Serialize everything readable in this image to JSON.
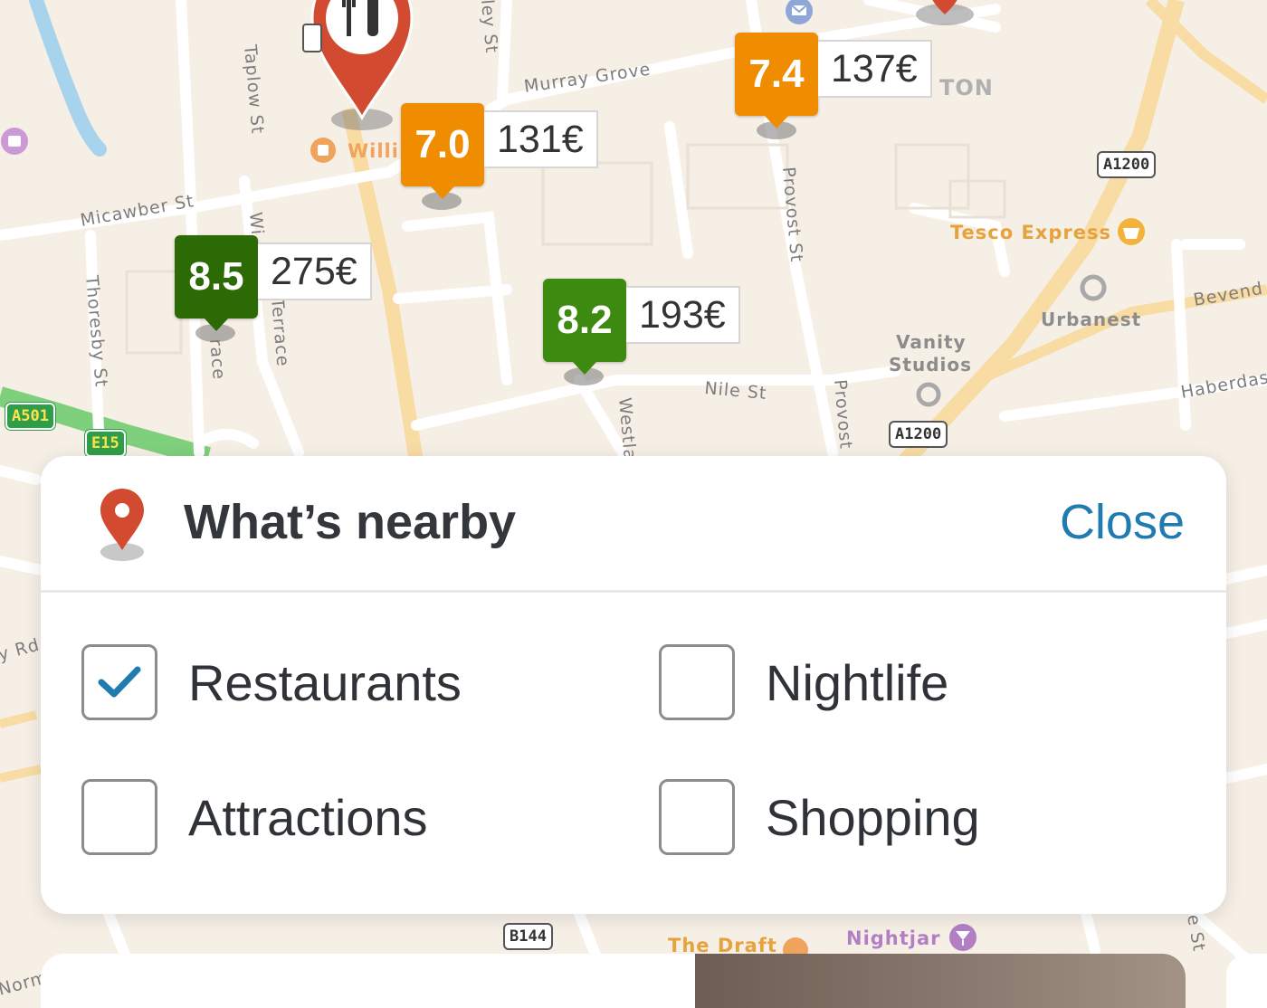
{
  "map": {
    "streets": [
      "Murray Grove",
      "Micawber St",
      "Taplow St",
      "Thoresby St",
      "Provost St",
      "Nile St",
      "Westla",
      "Provost",
      "Haberdas",
      "Bevend",
      "Wi",
      "Terrace",
      "race",
      "ley St",
      "y Rd",
      "Norm",
      "e St"
    ],
    "pois": {
      "tesco": "Tesco Express",
      "urbanest": "Urbanest",
      "vanity": "Vanity",
      "studios": "Studios",
      "ton": "TON",
      "willi": "Willi",
      "draft": "The Draft",
      "nightjar": "Nightjar"
    },
    "shields": {
      "a1200_top": "A1200",
      "a1200_mid": "A1200",
      "a501": "A501",
      "e15": "E15",
      "b144": "B144"
    }
  },
  "hotels": [
    {
      "score": "7.0",
      "price": "131€",
      "color": "#f08c00"
    },
    {
      "score": "7.4",
      "price": "137€",
      "color": "#f08c00"
    },
    {
      "score": "8.5",
      "price": "275€",
      "color": "#2c6a05"
    },
    {
      "score": "8.2",
      "price": "193€",
      "color": "#3c8a0f"
    }
  ],
  "panel": {
    "title": "What’s nearby",
    "close_label": "Close",
    "options": [
      {
        "label": "Restaurants",
        "checked": true
      },
      {
        "label": "Nightlife",
        "checked": false
      },
      {
        "label": "Attractions",
        "checked": false
      },
      {
        "label": "Shopping",
        "checked": false
      }
    ]
  },
  "colors": {
    "pin_red": "#d24a2f",
    "accent_blue": "#1f7bb0",
    "check_blue": "#1f7bb0"
  },
  "icons": [
    "restaurant-pin-icon",
    "location-pin-icon",
    "checkmark-icon",
    "mail-icon",
    "basket-icon",
    "bar-icon",
    "cafe-icon"
  ]
}
